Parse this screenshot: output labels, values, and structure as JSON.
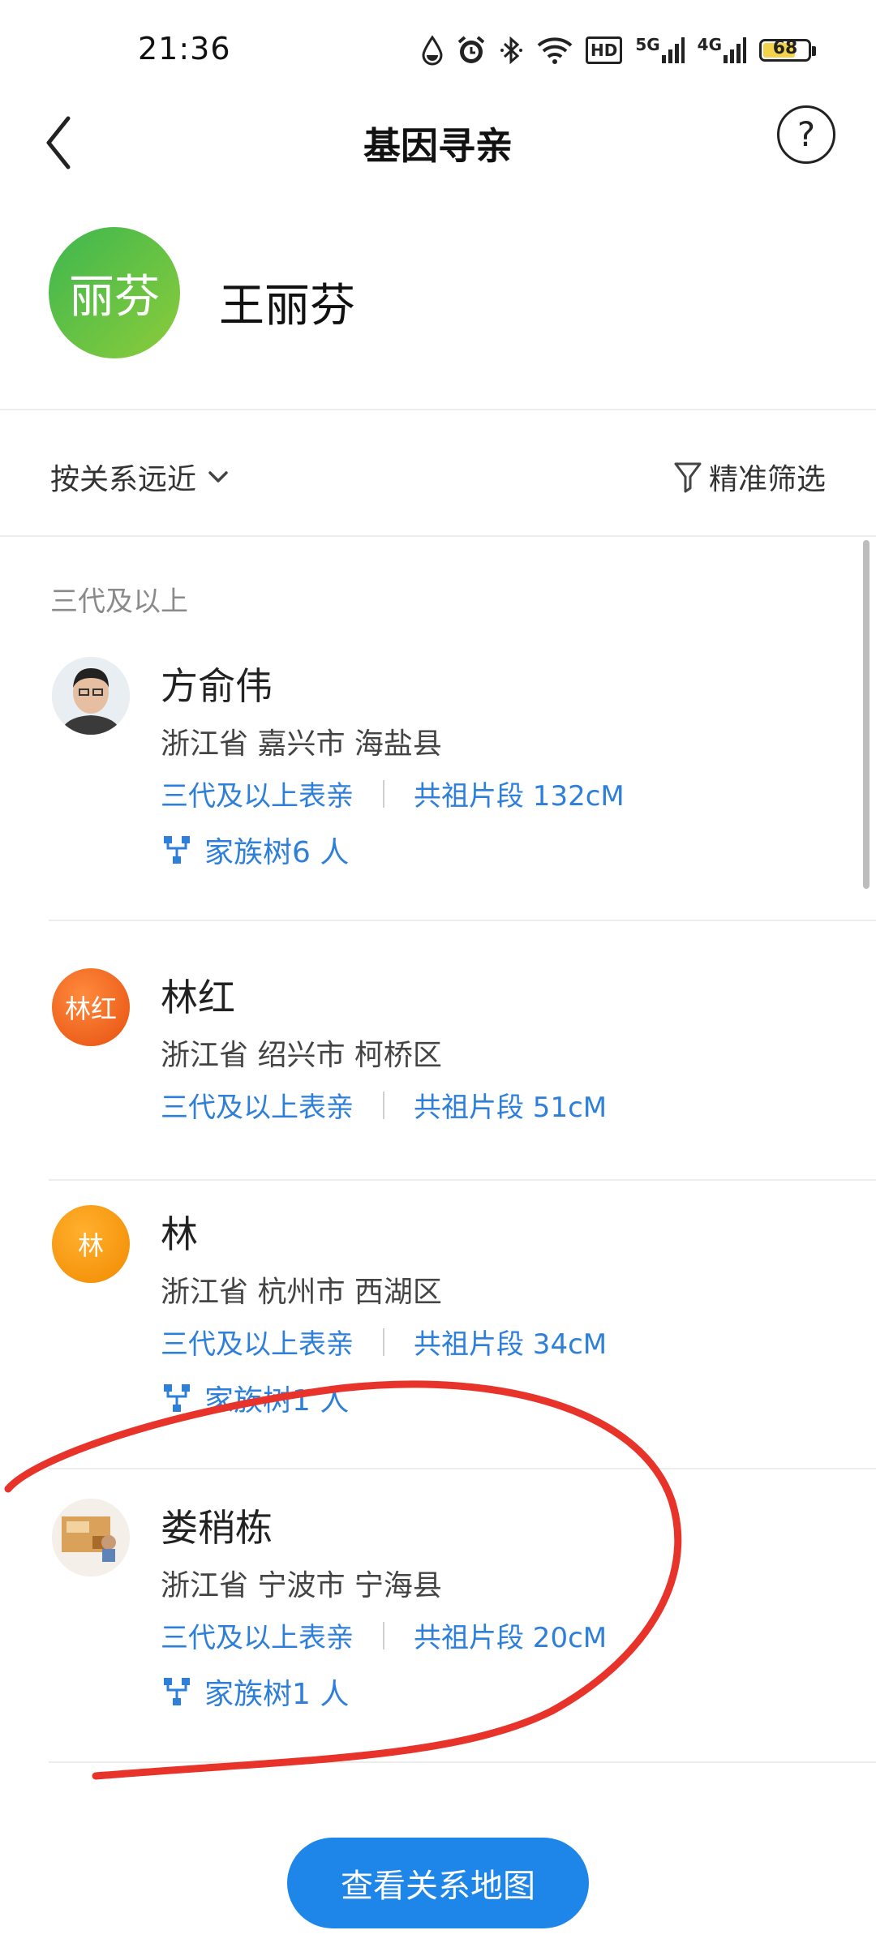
{
  "status_bar": {
    "time": "21:36",
    "icons": [
      "drop-icon",
      "alarm-icon",
      "bluetooth-icon",
      "wifi-icon",
      "hd-icon",
      "signal-5g-icon",
      "signal-4g-icon"
    ],
    "hd": "HD",
    "net1": "5G",
    "net2": "4G",
    "battery": "68"
  },
  "header": {
    "title": "基因寻亲",
    "help": "?"
  },
  "profile": {
    "avatar_text": "丽芬",
    "name": "王丽芬"
  },
  "filters": {
    "sort_label": "按关系远近",
    "filter_label": "精准筛选"
  },
  "list": {
    "section_title": "三代及以上",
    "items": [
      {
        "name": "方俞伟",
        "location": "浙江省 嘉兴市 海盐县",
        "relation": "三代及以上表亲",
        "segment": "共祖片段 132cM",
        "tree": "家族树6 人",
        "avatar_text": ""
      },
      {
        "name": "林红",
        "location": "浙江省 绍兴市 柯桥区",
        "relation": "三代及以上表亲",
        "segment": "共祖片段 51cM",
        "tree": "",
        "avatar_text": "林红"
      },
      {
        "name": "林",
        "location": "浙江省 杭州市 西湖区",
        "relation": "三代及以上表亲",
        "segment": "共祖片段 34cM",
        "tree": "家族树1 人",
        "avatar_text": "林"
      },
      {
        "name": "娄稍栋",
        "location": "浙江省 宁波市 宁海县",
        "relation": "三代及以上表亲",
        "segment": "共祖片段 20cM",
        "tree": "家族树1 人",
        "avatar_text": ""
      }
    ]
  },
  "bottom_button": "查看关系地图",
  "colors": {
    "accent": "#1e86e8",
    "link": "#2e7fd9",
    "annotation": "#e8332a"
  }
}
